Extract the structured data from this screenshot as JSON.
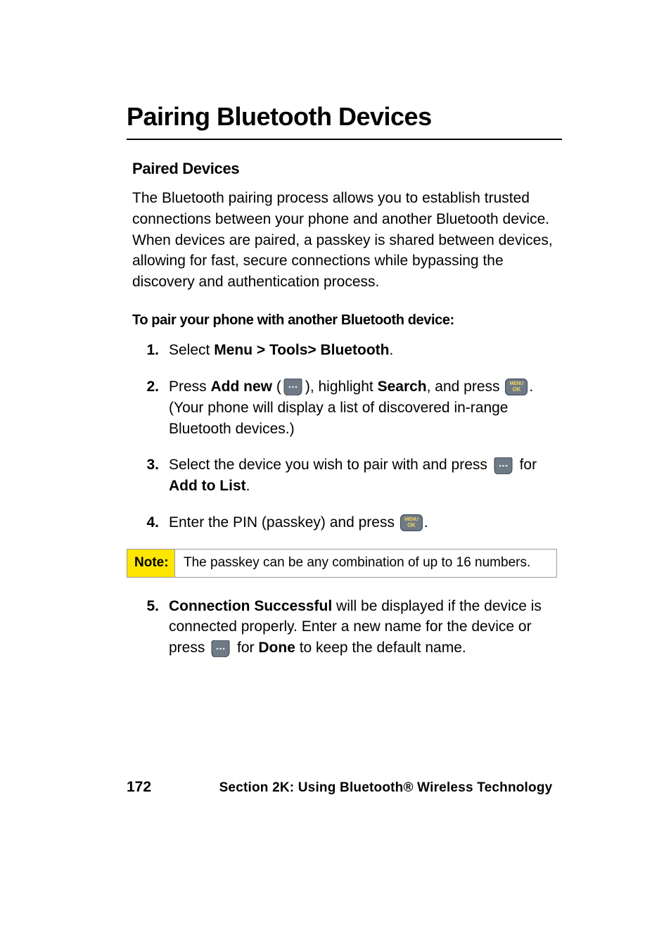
{
  "title": "Pairing Bluetooth Devices",
  "section_title": "Paired Devices",
  "intro": "The Bluetooth pairing process allows you to establish trusted connections between your phone and another Bluetooth device. When devices are paired, a passkey is shared between devices, allowing for fast, secure connections while bypassing the discovery and authentication process.",
  "subhead": "To pair your phone with another Bluetooth device:",
  "steps": {
    "s1": {
      "num": "1.",
      "a": "Select ",
      "b": "Menu > Tools> Bluetooth",
      "c": "."
    },
    "s2": {
      "num": "2.",
      "a": "Press ",
      "b": "Add new",
      "c": " (",
      "d": "), highlight ",
      "e": "Search",
      "f": ", and press ",
      "g": ". (Your phone will display a list of discovered in-range Bluetooth devices.)"
    },
    "s3": {
      "num": "3.",
      "a": "Select the device you wish to pair with and press ",
      "b": " for ",
      "c": "Add to List",
      "d": "."
    },
    "s4": {
      "num": "4.",
      "a": "Enter the PIN (passkey) and press ",
      "b": "."
    },
    "s5": {
      "num": "5.",
      "a": "Connection Successful",
      "b": " will be displayed if the device is connected properly. Enter a new name for the device or press ",
      "c": " for ",
      "d": "Done",
      "e": " to keep the default name."
    }
  },
  "note": {
    "label": "Note:",
    "text": "The passkey can be any combination of up to 16 numbers."
  },
  "footer": {
    "page": "172",
    "text": "Section 2K: Using Bluetooth® Wireless Technology"
  },
  "icons": {
    "softkey_left": "softkey-left-icon",
    "menu_ok": "menu-ok-icon"
  }
}
